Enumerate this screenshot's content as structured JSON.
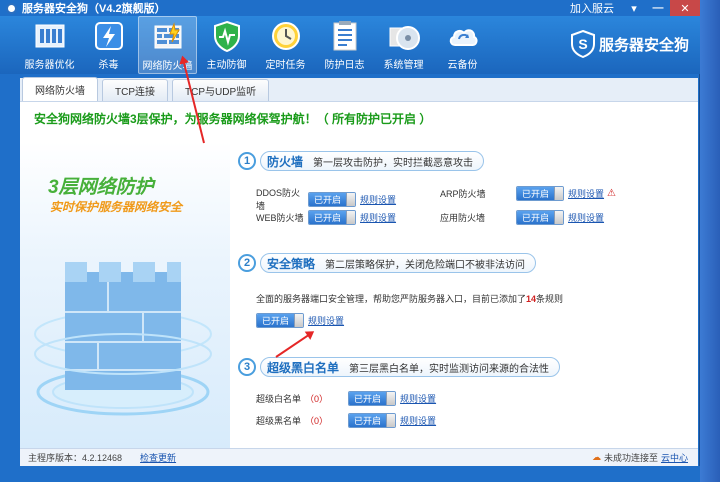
{
  "window": {
    "title": "服务器安全狗（V4.2旗舰版）",
    "join": "加入服云"
  },
  "toolbar": [
    {
      "label": "服务器优化",
      "icon": "server-optimize-icon"
    },
    {
      "label": "杀毒",
      "icon": "antivirus-icon"
    },
    {
      "label": "网络防火墙",
      "icon": "firewall-icon"
    },
    {
      "label": "主动防御",
      "icon": "active-defense-icon"
    },
    {
      "label": "定时任务",
      "icon": "clock-icon"
    },
    {
      "label": "防护日志",
      "icon": "log-icon"
    },
    {
      "label": "系统管理",
      "icon": "disk-icon"
    },
    {
      "label": "云备份",
      "icon": "cloud-backup-icon"
    }
  ],
  "brand": "服务器安全狗",
  "tabs": [
    "网络防火墙",
    "TCP连接",
    "TCP与UDP监听"
  ],
  "notice": "安全狗网络防火墙3层保护，为服务器网络保驾护航！（ 所有防护已开启 ）",
  "art": {
    "title": "3层网络防护",
    "subtitle": "实时保护服务器网络安全"
  },
  "sections": {
    "firewall": {
      "num": "1",
      "title": "防火墙",
      "desc": "第一层攻击防护，实时拦截恶意攻击"
    },
    "policy": {
      "num": "2",
      "title": "安全策略",
      "desc": "第二层策略保护，关闭危险端口不被非法访问"
    },
    "blacklist": {
      "num": "3",
      "title": "超级黑白名单",
      "desc": "第三层黑白名单，实时监测访问来源的合法性"
    }
  },
  "firewall_rows": {
    "ddos": "DDOS防火墙",
    "web": "WEB防火墙",
    "arp": "ARP防火墙",
    "app": "应用防火墙"
  },
  "policy_desc": {
    "before": "全面的服务器端口安全管理，帮助您严防服务器入口，目前已添加了",
    "count": "14",
    "after": "条规则"
  },
  "whitelist": {
    "white": "超级白名单",
    "black": "超级黑名单",
    "count": "（0）"
  },
  "toggle_on": "已开启",
  "rule_setting": "规则设置",
  "status": {
    "version": "主程序版本：4.2.12468",
    "update": "检查更新",
    "cloud_text": "未成功连接至",
    "cloud_link": "云中心"
  },
  "colors": {
    "accent": "#1f6fc9",
    "green": "#47b03a",
    "orange": "#f09a1a",
    "red": "#e52727"
  }
}
